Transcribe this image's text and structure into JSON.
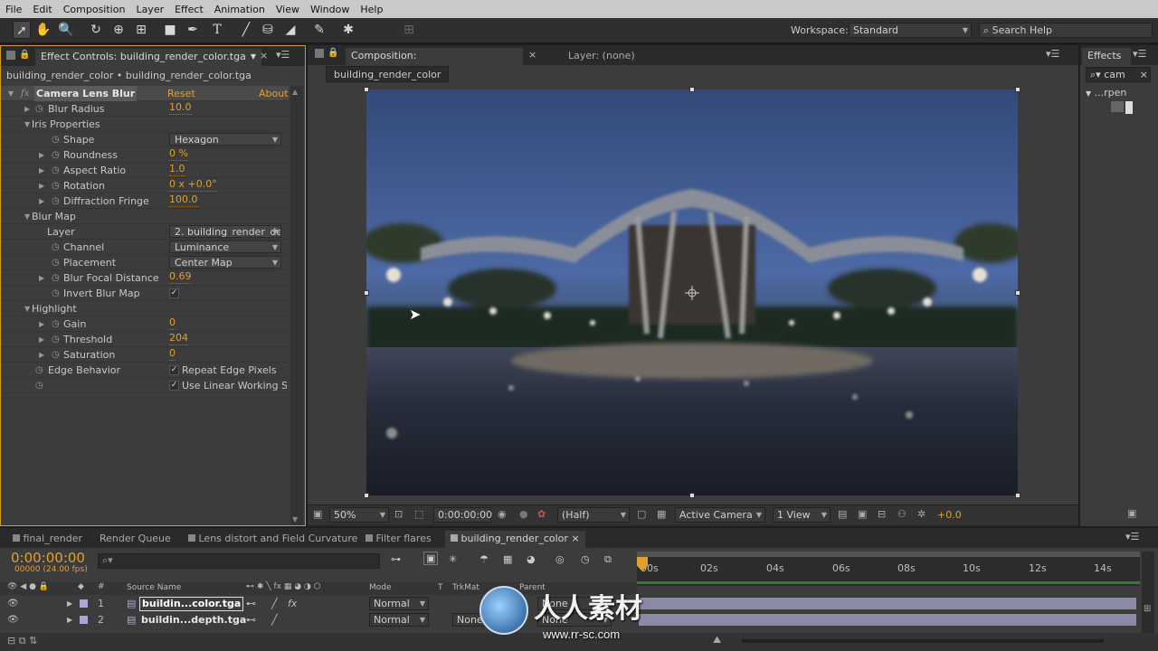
{
  "menu": [
    "File",
    "Edit",
    "Composition",
    "Layer",
    "Effect",
    "Animation",
    "View",
    "Window",
    "Help"
  ],
  "toolbar": {
    "workspace_label": "Workspace:",
    "workspace_value": "Standard",
    "search_placeholder": "Search Help"
  },
  "effect_controls": {
    "tab_title": "Effect Controls: building_render_color.tga",
    "breadcrumb": "building_render_color • building_render_color.tga",
    "effect_name": "Camera Lens Blur",
    "reset_label": "Reset",
    "about_label": "About...",
    "rows": {
      "blur_radius": {
        "label": "Blur Radius",
        "value": "10.0"
      },
      "iris_properties": {
        "label": "Iris Properties"
      },
      "shape": {
        "label": "Shape",
        "value": "Hexagon"
      },
      "roundness": {
        "label": "Roundness",
        "value": "0 %"
      },
      "aspect_ratio": {
        "label": "Aspect Ratio",
        "value": "1.0"
      },
      "rotation": {
        "label": "Rotation",
        "value": "0 x +0.0°"
      },
      "diffraction_fringe": {
        "label": "Diffraction Fringe",
        "value": "100.0"
      },
      "blur_map": {
        "label": "Blur Map"
      },
      "layer": {
        "label": "Layer",
        "value": "2. building_render_de"
      },
      "channel": {
        "label": "Channel",
        "value": "Luminance"
      },
      "placement": {
        "label": "Placement",
        "value": "Center Map"
      },
      "blur_focal_distance": {
        "label": "Blur Focal Distance",
        "value": "0.69"
      },
      "invert_blur_map": {
        "label": "Invert Blur Map"
      },
      "highlight": {
        "label": "Highlight"
      },
      "gain": {
        "label": "Gain",
        "value": "0"
      },
      "threshold": {
        "label": "Threshold",
        "value": "204"
      },
      "saturation": {
        "label": "Saturation",
        "value": "0"
      },
      "edge_behavior": {
        "label": "Edge Behavior",
        "value": "Repeat Edge Pixels"
      },
      "linear": {
        "value": "Use Linear Working Spa"
      }
    }
  },
  "composition": {
    "tab_title": "Composition: building_render_color",
    "layer_tab": "Layer: (none)",
    "subtab": "building_render_color",
    "zoom": "50%",
    "timecode": "0:00:00:00",
    "resolution": "(Half)",
    "camera": "Active Camera",
    "views": "1 View",
    "exposure": "+0.0"
  },
  "effects_panel": {
    "title": "Effects",
    "search": "cam",
    "item": "...rpen"
  },
  "timeline": {
    "tabs": [
      "final_render",
      "Render Queue",
      "Lens distort and Field Curvature",
      "Filter flares",
      "building_render_color"
    ],
    "timecode": "0:00:00:00",
    "fps": "00000 (24.00 fps)",
    "columns": {
      "hash": "#",
      "source": "Source Name",
      "mode": "Mode",
      "t": "T",
      "trkmat": "TrkMat",
      "parent": "Parent"
    },
    "ruler": [
      "00s",
      "02s",
      "04s",
      "06s",
      "08s",
      "10s",
      "12s",
      "14s"
    ],
    "layers": [
      {
        "num": "1",
        "name": "buildin...color.tga",
        "mode": "Normal",
        "parent": "None"
      },
      {
        "num": "2",
        "name": "buildin...depth.tga",
        "mode": "Normal",
        "trkmat": "None",
        "parent": "None"
      }
    ]
  },
  "watermark": {
    "cn": "人人素材",
    "url": "www.rr-sc.com"
  },
  "colors": {
    "accent": "#e0a030",
    "timecode": "#e0a030",
    "track_bar": "#8a8aa8",
    "work_area": "#2e7d32"
  }
}
